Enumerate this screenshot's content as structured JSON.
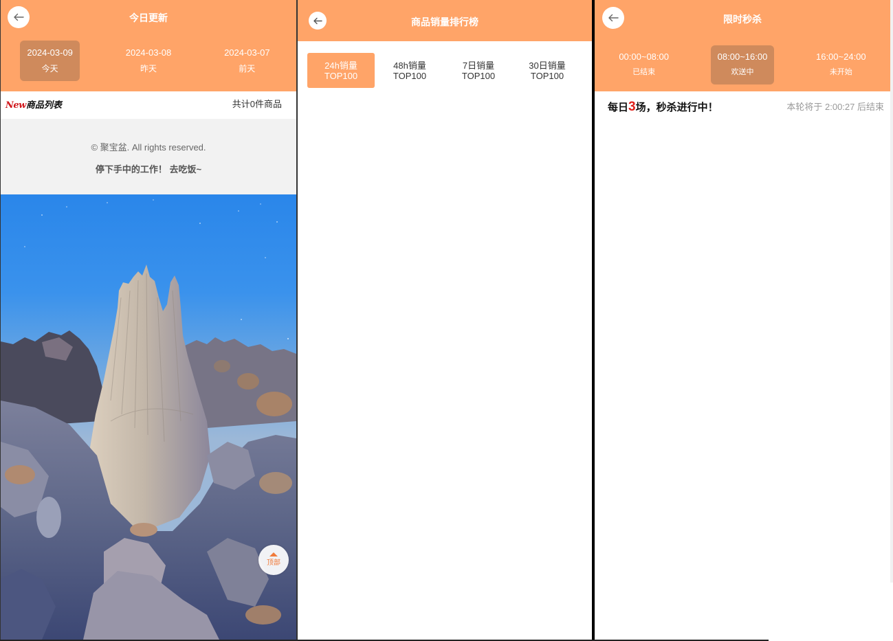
{
  "today": {
    "title": "今日更新",
    "dates": [
      {
        "date": "2024-03-09",
        "label": "今天",
        "selected": true
      },
      {
        "date": "2024-03-08",
        "label": "昨天",
        "selected": false
      },
      {
        "date": "2024-03-07",
        "label": "前天",
        "selected": false
      }
    ],
    "logo_new": "New",
    "logo_text": "商品列表",
    "count_text": "共计0件商品",
    "footer_copyright": "© 聚宝盆. All rights reserved.",
    "footer_tagline": "停下手中的工作！ 去吃饭~",
    "back_to_top": "顶部"
  },
  "ranking": {
    "title": "商品销量排行榜",
    "tabs": [
      {
        "line1": "24h销量",
        "line2": "TOP100",
        "selected": true
      },
      {
        "line1": "48h销量",
        "line2": "TOP100",
        "selected": false
      },
      {
        "line1": "7日销量",
        "line2": "TOP100",
        "selected": false
      },
      {
        "line1": "30日销量",
        "line2": "TOP100",
        "selected": false
      }
    ]
  },
  "flash": {
    "title": "限时秒杀",
    "slots": [
      {
        "time": "00:00~08:00",
        "status": "已结束",
        "selected": false
      },
      {
        "time": "08:00~16:00",
        "status": "欢送中",
        "selected": true
      },
      {
        "time": "16:00~24:00",
        "status": "未开始",
        "selected": false
      }
    ],
    "banner_prefix": "每日",
    "banner_count": "3",
    "banner_suffix": "场，秒杀进行中！",
    "countdown": "本轮将于 2:00:27 后结束"
  },
  "icons": {
    "back": "arrow-left-icon",
    "to_top": "triangle-up-icon"
  },
  "colors": {
    "header": "#FFA468",
    "tab_selected": "#CF8A5C",
    "accent_red": "#E0201A",
    "text_dark": "#333333",
    "text_muted": "#999999"
  }
}
